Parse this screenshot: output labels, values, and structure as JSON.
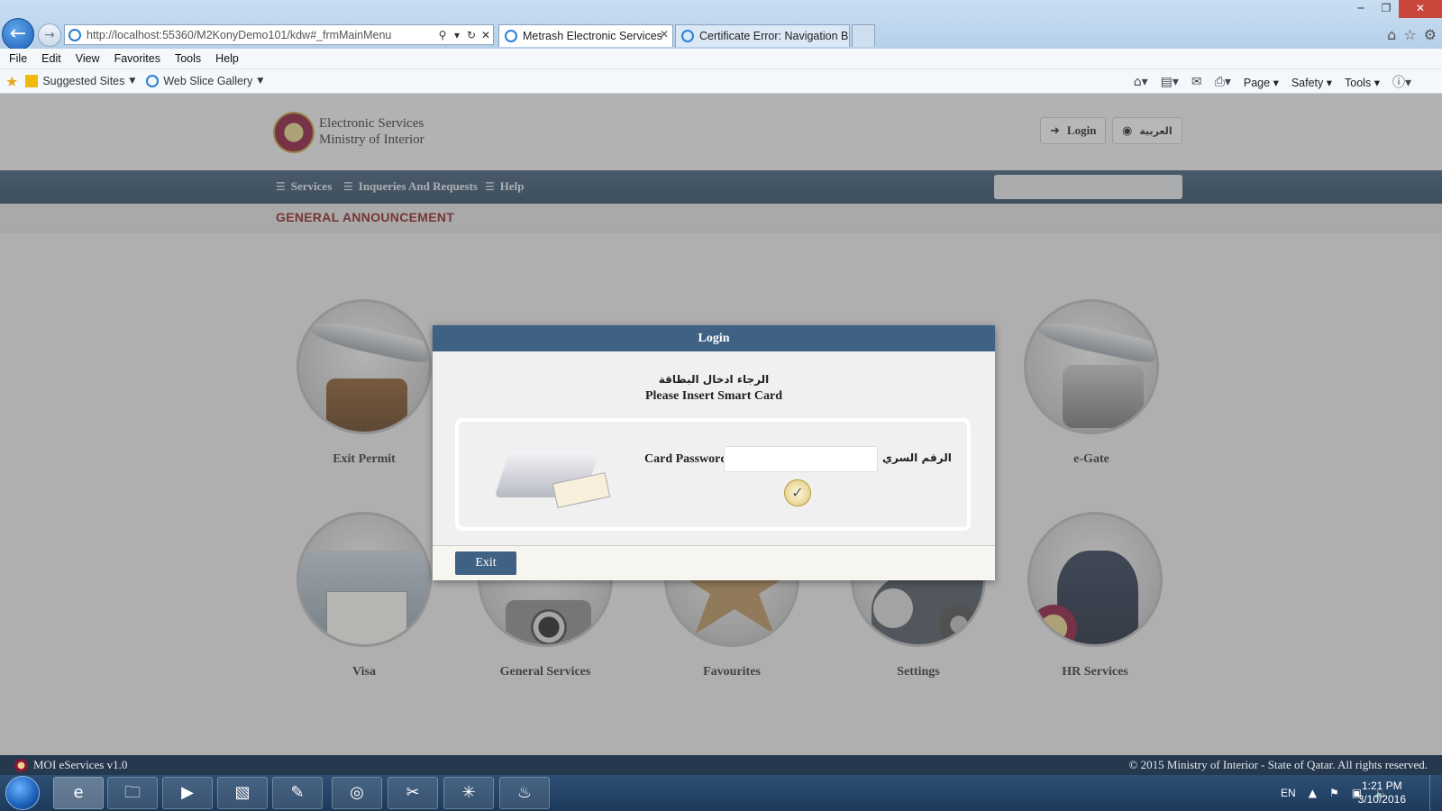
{
  "browser": {
    "url_host": "localhost",
    "url": "http://localhost:55360/M2KonyDemo101/kdw#_frmMainMenu",
    "tabs": [
      {
        "label": "Metrash Electronic Services",
        "active": true
      },
      {
        "label": "Certificate Error: Navigation Bl...",
        "active": false
      }
    ],
    "menu": [
      "File",
      "Edit",
      "View",
      "Favorites",
      "Tools",
      "Help"
    ],
    "favorites": [
      {
        "label": "Suggested Sites",
        "icon": "bing-icon"
      },
      {
        "label": "Web Slice Gallery",
        "icon": "web-slice-icon"
      }
    ],
    "command_bar": {
      "page": "Page",
      "safety": "Safety",
      "tools": "Tools"
    }
  },
  "site": {
    "title_line1": "Electronic Services",
    "title_line2": "Ministry of Interior",
    "login_label": "Login",
    "arabic_label": "العربية",
    "nav": [
      {
        "label": "Services"
      },
      {
        "label": "Inqueries And Requests"
      },
      {
        "label": "Help"
      }
    ],
    "announcement": "GENERAL ANNOUNCEMENT",
    "tiles": [
      {
        "label": "Exit Permit",
        "icon": "exit-permit-icon"
      },
      {
        "label": "e-Gate",
        "icon": "e-gate-icon"
      },
      {
        "label": "Visa",
        "icon": "visa-icon"
      },
      {
        "label": "General Services",
        "icon": "camera-icon"
      },
      {
        "label": "Favourites",
        "icon": "star-icon"
      },
      {
        "label": "Settings",
        "icon": "gear-icon"
      },
      {
        "label": "HR Services",
        "icon": "hr-services-icon"
      }
    ]
  },
  "modal": {
    "title": "Login",
    "instruction_ar": "الرجاء ادخال البطاقة",
    "instruction_en": "Please Insert Smart Card",
    "password_label": "Card Password",
    "password_label_ar": "الرقم السري",
    "password_value": "",
    "exit_label": "Exit"
  },
  "footer": {
    "version": "MOI eServices v1.0",
    "copyright": "© 2015 Ministry of Interior - State of Qatar. All rights reserved."
  },
  "taskbar": {
    "language": "EN",
    "time": "1:21 PM",
    "date": "3/10/2016"
  },
  "colors": {
    "nav_blue": "#2b4761",
    "modal_header": "#3f6284",
    "announcement_red": "#8a1a1a",
    "footer": "#25384d"
  }
}
